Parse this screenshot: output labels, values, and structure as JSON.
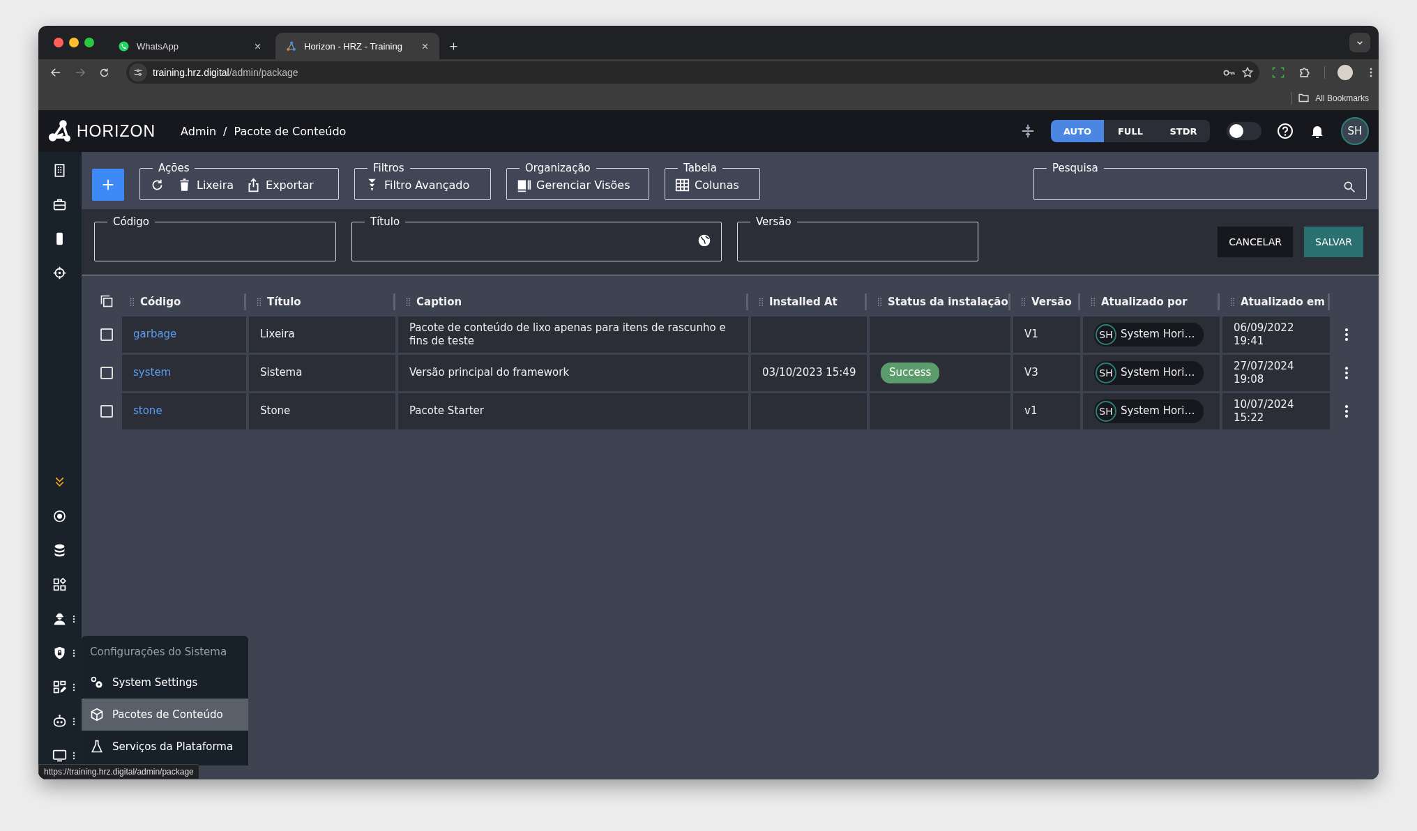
{
  "browser": {
    "tabs": [
      {
        "title": "WhatsApp",
        "kind": "whatsapp",
        "selected": false
      },
      {
        "title": "Horizon - HRZ - Training",
        "kind": "horizon",
        "selected": true
      }
    ],
    "forward_enabled": false,
    "url_host": "training.hrz.digital",
    "url_path": "/admin/package",
    "bookmarks": "All Bookmarks",
    "status_url": "https://training.hrz.digital/admin/package"
  },
  "header": {
    "logo": "HORIZON",
    "breadcrumb": [
      "Admin",
      "Pacote de Conteúdo"
    ],
    "breadcrumb_separator": "/",
    "density_modes": [
      {
        "label": "AUTO",
        "selected": true
      },
      {
        "label": "FULL",
        "selected": false
      },
      {
        "label": "STDR",
        "selected": false
      }
    ],
    "theme_toggle": {
      "on": false
    },
    "avatar": "SH"
  },
  "sidebar": {
    "top_items": [
      {
        "kind": "building",
        "submenu": false
      },
      {
        "kind": "briefcase",
        "submenu": false
      },
      {
        "kind": "device",
        "submenu": false
      },
      {
        "kind": "crosshair",
        "submenu": false
      }
    ],
    "bottom_items": [
      {
        "kind": "expand",
        "submenu": false
      },
      {
        "kind": "ring",
        "submenu": false
      },
      {
        "kind": "database",
        "submenu": false
      },
      {
        "kind": "apps",
        "submenu": false
      },
      {
        "kind": "worker",
        "submenu": true
      },
      {
        "kind": "shield",
        "submenu": true
      },
      {
        "kind": "formedit",
        "submenu": true
      },
      {
        "kind": "robot",
        "submenu": true
      },
      {
        "kind": "monitor",
        "submenu": true
      }
    ]
  },
  "toolbar": {
    "groups": [
      {
        "legend": "Ações",
        "buttons": [
          {
            "kind": "refresh"
          },
          {
            "kind": "trash",
            "label": "Lixeira"
          },
          {
            "kind": "export",
            "label": "Exportar"
          }
        ]
      },
      {
        "legend": "Filtros",
        "buttons": [
          {
            "kind": "filter",
            "label": "Filtro Avançado"
          }
        ]
      },
      {
        "legend": "Organização",
        "buttons": [
          {
            "kind": "views",
            "label": "Gerenciar Visões"
          }
        ]
      },
      {
        "legend": "Tabela",
        "buttons": [
          {
            "kind": "columns",
            "label": "Colunas"
          }
        ]
      }
    ],
    "search": {
      "legend": "Pesquisa"
    }
  },
  "form": {
    "fields": [
      {
        "label": "Código",
        "translatable": false
      },
      {
        "label": "Título",
        "translatable": true
      },
      {
        "label": "Versão",
        "translatable": false
      }
    ],
    "buttons": [
      {
        "label": "CANCELAR",
        "kind": "cancel"
      },
      {
        "label": "SALVAR",
        "kind": "save"
      }
    ]
  },
  "table": {
    "columns": [
      "Código",
      "Título",
      "Caption",
      "Installed At",
      "Status da instalação",
      "Versão",
      "Atualizado por",
      "Atualizado em"
    ],
    "rows": [
      {
        "checked": false,
        "code": "garbage",
        "title": "Lixeira",
        "caption": "Pacote de conteúdo de lixo apenas para itens de rascunho e fins de teste",
        "version": "V1",
        "updated_by": {
          "initials": "SH",
          "name": "System Hori…"
        },
        "updated_at": "06/09/2022 19:41"
      },
      {
        "checked": false,
        "code": "system",
        "title": "Sistema",
        "caption": "Versão principal do framework",
        "installed_at": "03/10/2023 15:49",
        "status": "Success",
        "version": "V3",
        "updated_by": {
          "initials": "SH",
          "name": "System Hori…"
        },
        "updated_at": "27/07/2024 19:08"
      },
      {
        "checked": false,
        "code": "stone",
        "title": "Stone",
        "caption": "Pacote Starter",
        "version": "v1",
        "updated_by": {
          "initials": "SH",
          "name": "System Hori…"
        },
        "updated_at": "10/07/2024 15:22"
      }
    ]
  },
  "menu": {
    "title": "Configurações do Sistema",
    "items": [
      {
        "label": "System Settings",
        "kind": "gears",
        "selected": false
      },
      {
        "label": "Pacotes de Conteúdo",
        "kind": "box",
        "selected": true
      },
      {
        "label": "Serviços da Plataforma",
        "kind": "flask",
        "selected": false
      }
    ]
  }
}
